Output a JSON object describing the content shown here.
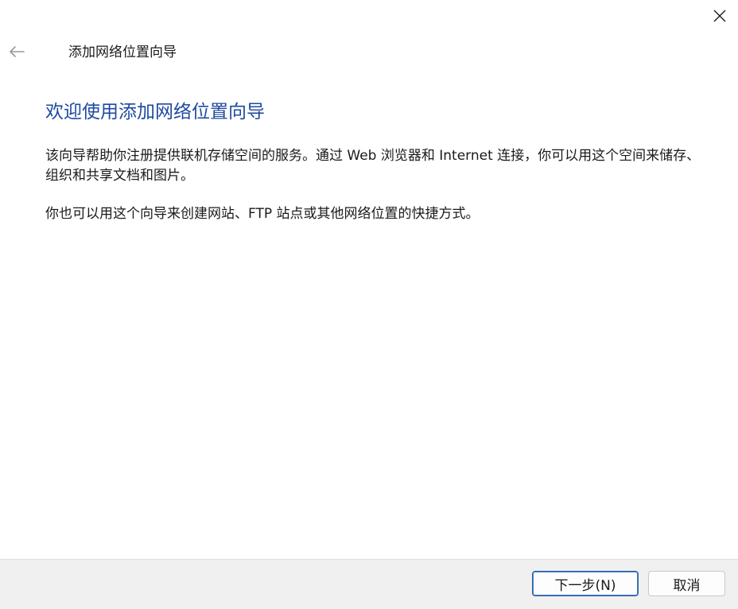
{
  "window": {
    "close_icon": "close-icon",
    "back_icon": "back-arrow-icon"
  },
  "header": {
    "title": "添加网络位置向导"
  },
  "main": {
    "heading": "欢迎使用添加网络位置向导",
    "paragraph1": "该向导帮助你注册提供联机存储空间的服务。通过 Web 浏览器和 Internet 连接，你可以用这个空间来储存、组织和共享文档和图片。",
    "paragraph2": "你也可以用这个向导来创建网站、FTP 站点或其他网络位置的快捷方式。"
  },
  "footer": {
    "next_label": "下一步(N)",
    "cancel_label": "取消"
  },
  "colors": {
    "heading": "#1f4aa0",
    "default_button_border": "#2b5da8",
    "footer_background": "#f0f0f0"
  }
}
